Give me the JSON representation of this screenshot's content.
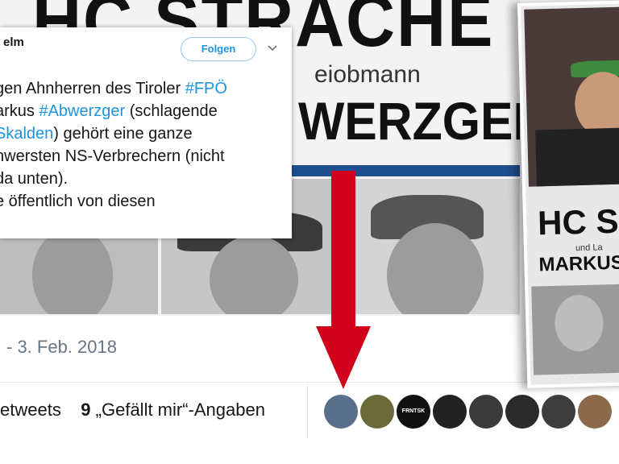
{
  "poster": {
    "headline": "HC STRACHE",
    "subtitle": "eiobmann",
    "name": "WERZGER"
  },
  "tweet": {
    "handle": "elm",
    "follow_label": "Folgen",
    "chevron_icon": "chevron-down-icon",
    "lines": [
      {
        "pre": "gen Ahnherren des Tiroler ",
        "tag": "#FPÖ",
        "post": ""
      },
      {
        "pre": "arkus ",
        "tag": "#Abwerzger",
        "post": " (schlagende"
      },
      {
        "pre": "",
        "tag": "Skalden",
        "post": ") gehört eine ganze"
      },
      {
        "pre": "hwersten NS-Verbrechern (nicht",
        "tag": "",
        "post": ""
      },
      {
        "pre": " da unten).",
        "tag": "",
        "post": ""
      },
      {
        "pre": "e öffentlich von diesen",
        "tag": "",
        "post": ""
      }
    ]
  },
  "footer": {
    "date": "- 3. Feb. 2018",
    "retweets_label": "etweets",
    "likes_count": "9",
    "likes_label": "„Gefällt mir“-Angaben"
  },
  "avatars": [
    {
      "name": "avatar-1",
      "color": "#5a6f8a",
      "label": ""
    },
    {
      "name": "avatar-2",
      "color": "#6b6b3a",
      "label": ""
    },
    {
      "name": "avatar-3",
      "color": "#111111",
      "label": "FRNTSK CPR"
    },
    {
      "name": "avatar-4",
      "color": "#222222",
      "label": ""
    },
    {
      "name": "avatar-5",
      "color": "#3a3a3a",
      "label": ""
    },
    {
      "name": "avatar-6",
      "color": "#2a2a2a",
      "label": ""
    },
    {
      "name": "avatar-7",
      "color": "#3d3d3d",
      "label": ""
    },
    {
      "name": "avatar-8",
      "color": "#8a6a4a",
      "label": ""
    }
  ],
  "side_poster": {
    "headline": "HC S",
    "small": "und La",
    "name": "MARKUS"
  },
  "colors": {
    "arrow": "#d0021b",
    "link": "#1b95e0",
    "poster_bar": "#1f4f8f"
  }
}
